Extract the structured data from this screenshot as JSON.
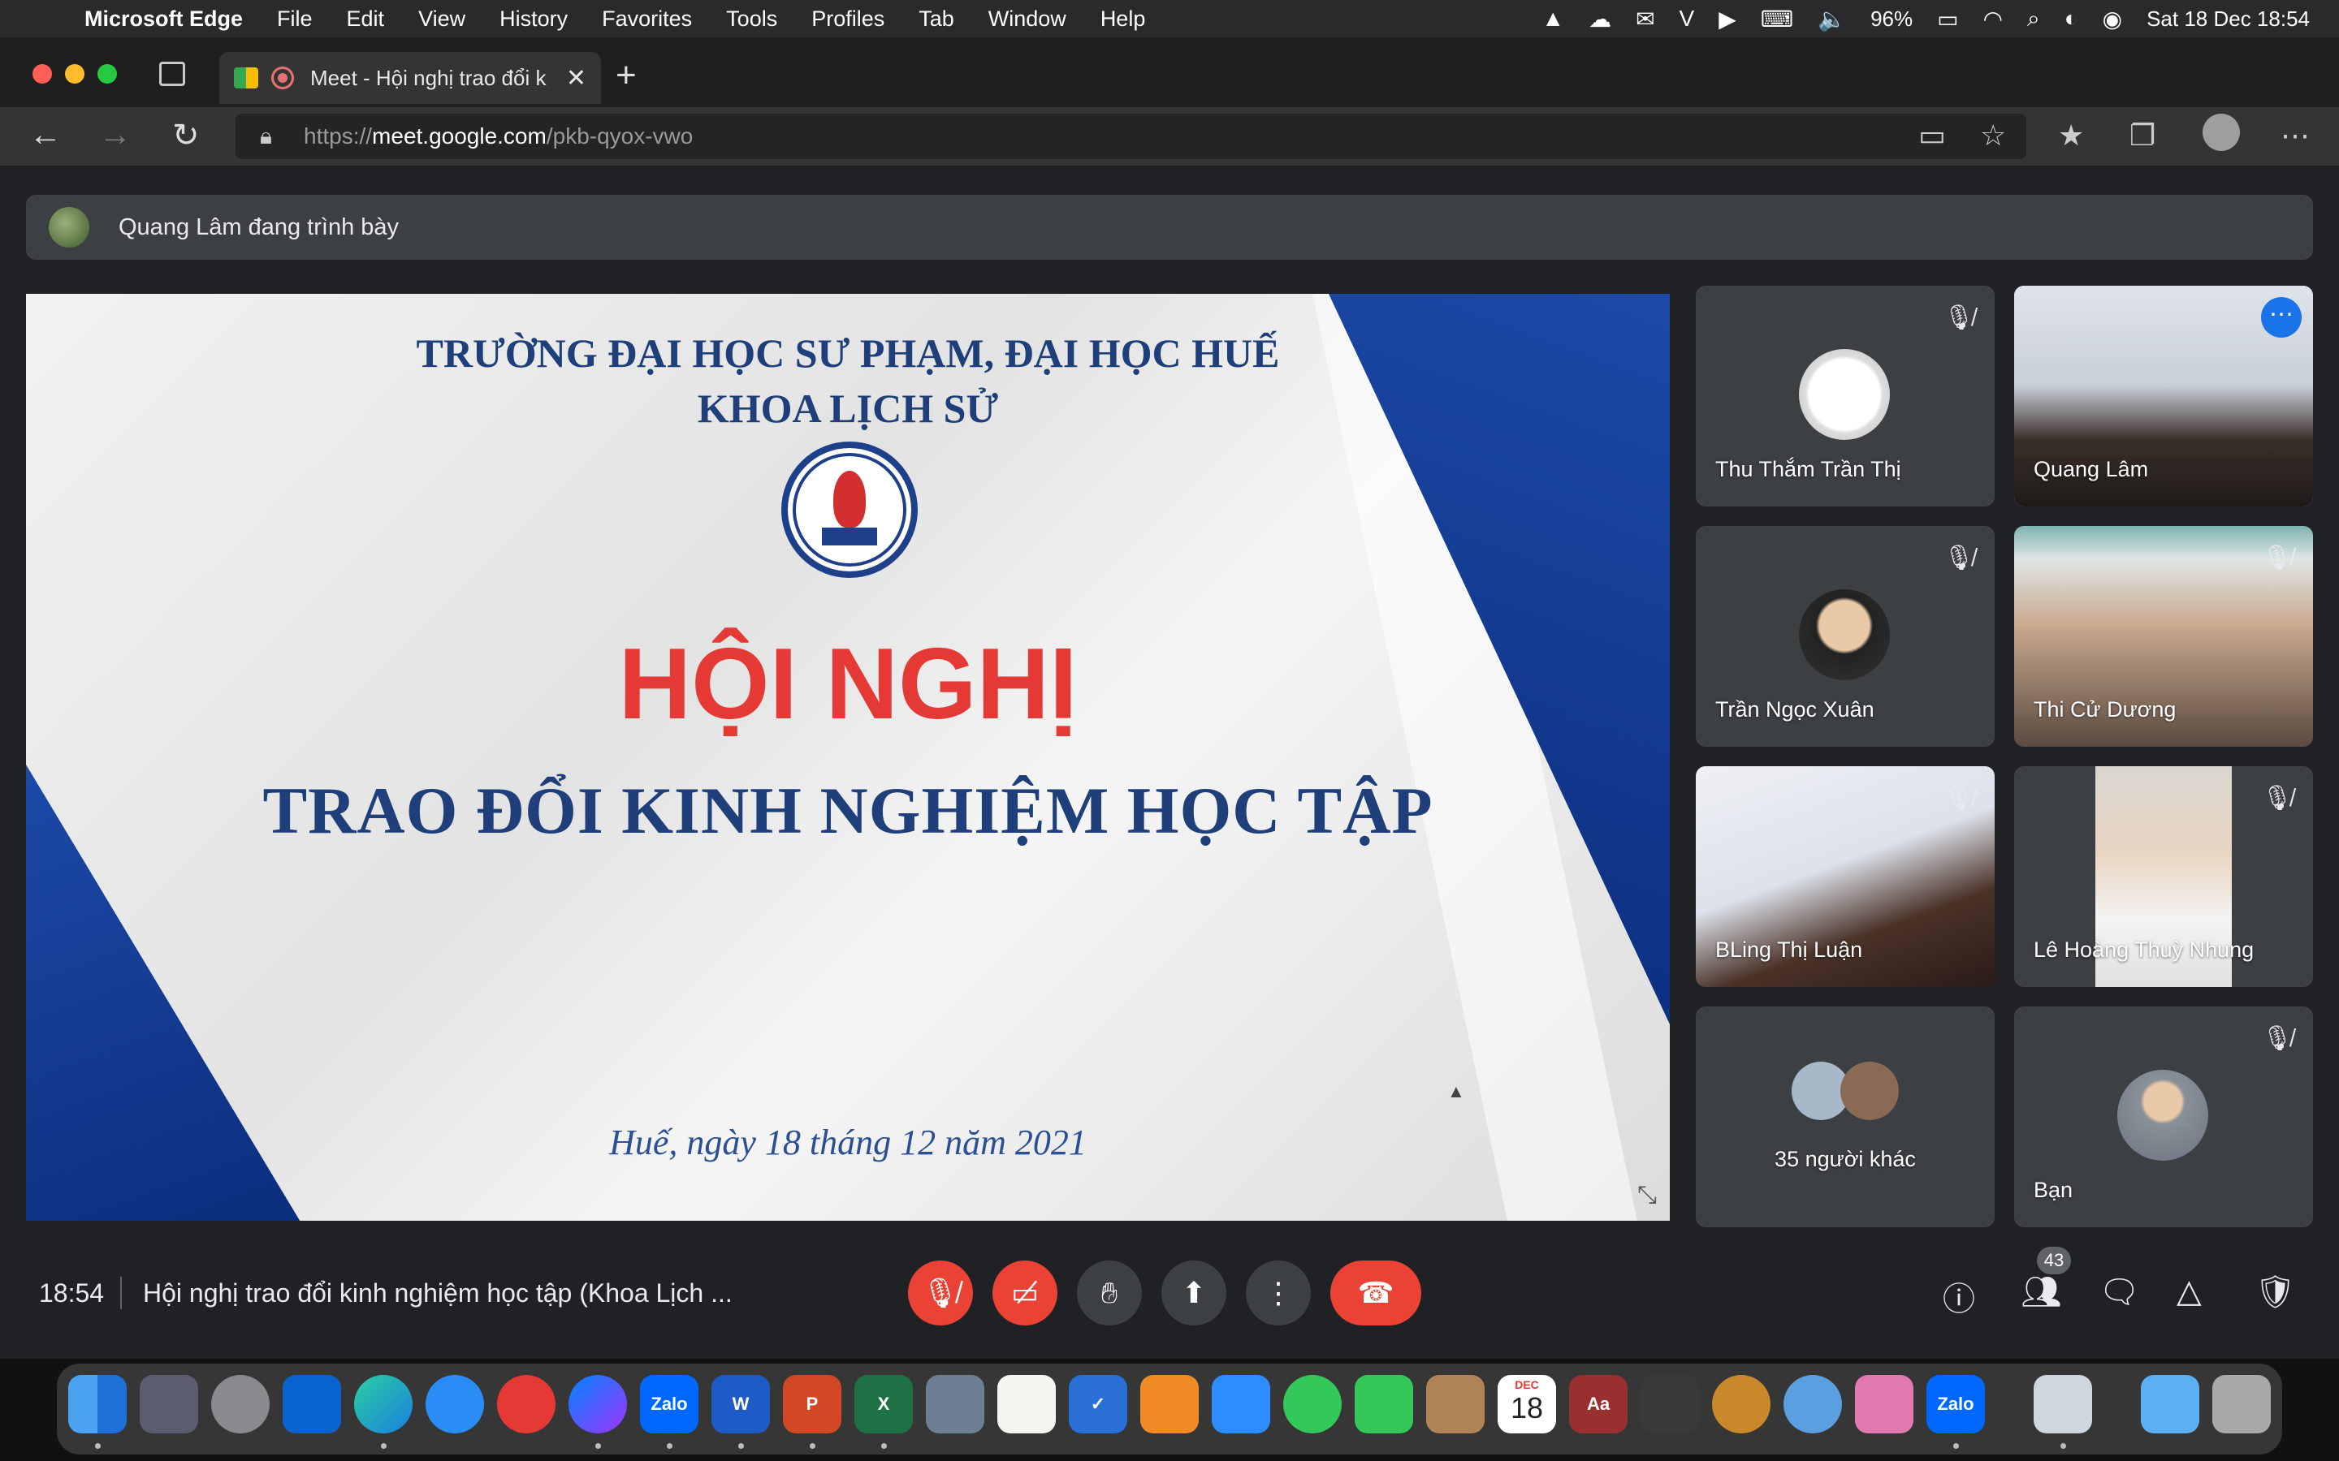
{
  "menubar": {
    "app_name": "Microsoft Edge",
    "menus": [
      "File",
      "Edit",
      "View",
      "History",
      "Favorites",
      "Tools",
      "Profiles",
      "Tab",
      "Window",
      "Help"
    ],
    "battery": "96%",
    "datetime": "Sat 18 Dec  18:54"
  },
  "browser": {
    "tab_title": "Meet - Hội nghị trao đổi k",
    "url_scheme": "https://",
    "url_host": "meet.google.com",
    "url_path": "/pkb-qyox-vwo"
  },
  "meet": {
    "presenting_text": "Quang Lâm đang trình bày",
    "slide": {
      "university": "TRƯỜNG ĐẠI HỌC SƯ PHẠM, ĐẠI HỌC HUẾ",
      "faculty": "KHOA LỊCH SỬ",
      "headline": "HỘI NGHỊ",
      "subheadline": "TRAO ĐỔI KINH NGHIỆM HỌC TẬP",
      "date_line": "Huế, ngày 18 tháng 12 năm 2021"
    },
    "participants": [
      {
        "name": "Thu Thắm Trần Thị",
        "muted": true
      },
      {
        "name": "Quang Lâm",
        "muted": false,
        "active": true
      },
      {
        "name": "Trần Ngọc Xuân",
        "muted": true
      },
      {
        "name": "Thi Cử Dương",
        "muted": true
      },
      {
        "name": "BLing Thị Luận",
        "muted": true
      },
      {
        "name": "Lê Hoàng Thuỳ Nhung",
        "muted": true
      },
      {
        "name": "35 người khác",
        "muted": false
      },
      {
        "name": "Bạn",
        "muted": true
      }
    ],
    "clock": "18:54",
    "meeting_title": "Hội nghị trao đổi kinh nghiệm học tập (Khoa Lịch ...",
    "participant_count": "43"
  },
  "dock": {
    "calendar_month": "DEC",
    "calendar_day": "18",
    "zalo_label": "Zalo",
    "dictionary_label": "Aa"
  },
  "colors": {
    "meet_bg": "#202124",
    "tile_bg": "#3c4043",
    "danger": "#ea4335",
    "active_border": "#8ab4f8",
    "slide_red": "#e53935",
    "slide_blue": "#1e3f7a"
  }
}
